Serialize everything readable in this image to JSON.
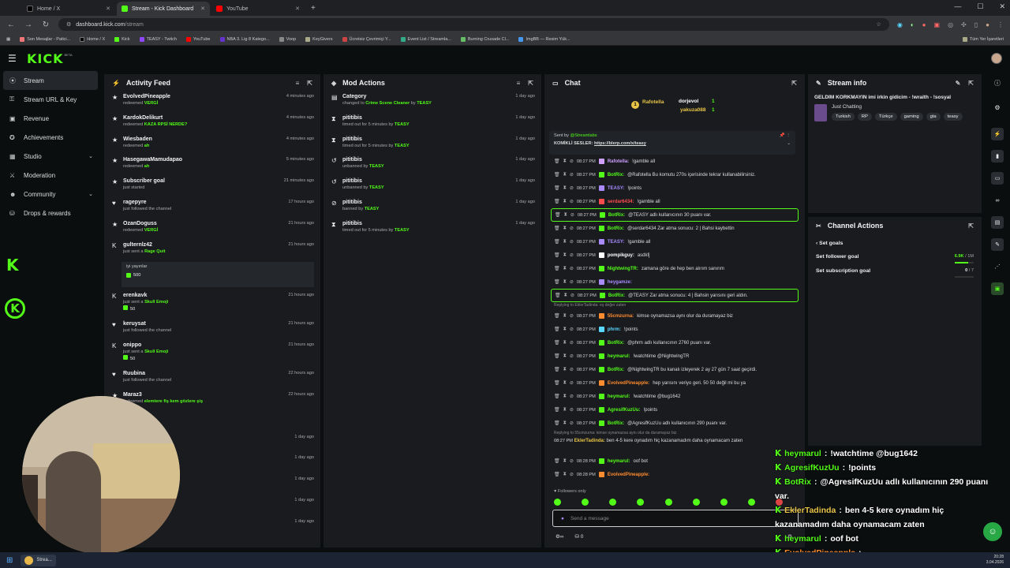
{
  "browser": {
    "tabs": [
      {
        "title": "Home / X",
        "color": "#000000"
      },
      {
        "title": "Stream - Kick Dashboard",
        "color": "#53fc18"
      },
      {
        "title": "YouTube",
        "color": "#ff0000"
      }
    ],
    "url_host": "dashboard.kick.com",
    "url_path": "/stream",
    "bookmarks": [
      "Son Mesajlar - Patici...",
      "Home / X",
      "Kick",
      "TEASY - Twitch",
      "YouTube",
      "NBA 3. Lig 8 Katego...",
      "Voop",
      "KeyGivers",
      "Ücretsiz Çevrimiçi Y...",
      "Event List / Streamla...",
      "Burning Crusade Cl...",
      "ImgBB — Resim Yük..."
    ],
    "bookmarks_right": "Tüm Yer İşaretleri"
  },
  "brand": {
    "logo": "KICK",
    "beta": "BETA",
    "accent": "#53fc18"
  },
  "nav": {
    "items": [
      {
        "label": "Stream",
        "icon": "stream-icon"
      },
      {
        "label": "Stream URL & Key",
        "icon": "key-icon"
      },
      {
        "label": "Revenue",
        "icon": "revenue-icon"
      },
      {
        "label": "Achievements",
        "icon": "achievements-icon"
      },
      {
        "label": "Studio",
        "icon": "studio-icon"
      },
      {
        "label": "Moderation",
        "icon": "moderation-icon"
      },
      {
        "label": "Community",
        "icon": "community-icon"
      },
      {
        "label": "Drops & rewards",
        "icon": "drops-icon"
      }
    ]
  },
  "activity": {
    "title": "Activity Feed",
    "rows": [
      {
        "name": "EvolvedPineapple",
        "pre": "redeemed ",
        "hl": "VERGİ",
        "time": "4 minutes ago",
        "icon": "★"
      },
      {
        "name": "KardokDelikurt",
        "pre": "redeemed ",
        "hl": "KAZA RPSİ NERDE?",
        "time": "4 minutes ago",
        "icon": "★"
      },
      {
        "name": "Wiesbaden",
        "pre": "redeemed ",
        "hl": "ah",
        "time": "4 minutes ago",
        "icon": "★"
      },
      {
        "name": "HasegawaMamudapao",
        "pre": "redeemed ",
        "hl": "ah",
        "time": "5 minutes ago",
        "icon": "★"
      },
      {
        "name": "Subscriber goal",
        "pre": "just started",
        "hl": "",
        "time": "21 minutes ago",
        "icon": "★"
      },
      {
        "name": "ragepyre",
        "pre": "just followed the channel",
        "hl": "",
        "time": "17 hours ago",
        "icon": "♥"
      },
      {
        "name": "OzanDoguss",
        "pre": "redeemed ",
        "hl": "VERGİ",
        "time": "21 hours ago",
        "icon": "★"
      },
      {
        "name": "gulternlz42",
        "pre": "just sent a ",
        "hl": "Rage Quit",
        "time": "21 hours ago",
        "icon": "K"
      }
    ],
    "gift_msg": "iyi yayınlar",
    "gift_amount": "500",
    "rows2": [
      {
        "name": "erenkavk",
        "pre": "just sent a ",
        "hl": "Skull Emoji",
        "time": "21 hours ago",
        "icon": "K",
        "amount": "50"
      },
      {
        "name": "keruysat",
        "pre": "just followed the channel",
        "hl": "",
        "time": "21 hours ago",
        "icon": "♥"
      },
      {
        "name": "onippo",
        "pre": "just sent a ",
        "hl": "Skull Emoji",
        "time": "21 hours ago",
        "icon": "K",
        "amount": "50"
      },
      {
        "name": "Ruubina",
        "pre": "just followed the channel",
        "hl": "",
        "time": "22 hours ago",
        "icon": "♥"
      },
      {
        "name": "Maraz3",
        "pre": "redeemed ",
        "hl": "elemtere fiş kem gözlere şiş",
        "time": "22 hours ago",
        "icon": "★"
      },
      {
        "name": "iber goal",
        "pre": "",
        "hl": "",
        "time": "",
        "icon": ""
      },
      {
        "name": "bscribed!",
        "pre": "bscribed for ",
        "hl": "20",
        "post": " months",
        "time": "1 day ago",
        "icon": ""
      },
      {
        "name": "",
        "pre": "",
        "hl": "",
        "time": "1 day ago",
        "icon": ""
      },
      {
        "name": "",
        "pre": "",
        "hl": "erakittyy",
        "time": "1 day ago",
        "icon": ""
      },
      {
        "name": "bed!",
        "pre": "ubscribed for ",
        "hl": "13",
        "post": " months",
        "time": "1 day ago",
        "icon": ""
      },
      {
        "name": "",
        "pre": "",
        "hl": "eraaii",
        "time": "1 day ago",
        "icon": ""
      }
    ]
  },
  "mod": {
    "title": "Mod Actions",
    "rows": [
      {
        "name": "Category",
        "sub1": "changed to ",
        "hl": "Crime Scene Cleaner",
        "sub2": " by ",
        "by": "TEASY",
        "time": "1 day ago",
        "icon": "▤"
      },
      {
        "name": "pititibis",
        "sub1": "timed out for 5 minutes by ",
        "hl": "",
        "sub2": "",
        "by": "TEASY",
        "time": "1 day ago",
        "icon": "⧗"
      },
      {
        "name": "pititibis",
        "sub1": "timed out for 5 minutes by ",
        "hl": "",
        "sub2": "",
        "by": "TEASY",
        "time": "1 day ago",
        "icon": "⧗"
      },
      {
        "name": "pititibis",
        "sub1": "unbanned by ",
        "hl": "",
        "sub2": "",
        "by": "TEASY",
        "time": "1 day ago",
        "icon": "↺"
      },
      {
        "name": "pititibis",
        "sub1": "unbanned by ",
        "hl": "",
        "sub2": "",
        "by": "TEASY",
        "time": "1 day ago",
        "icon": "↺"
      },
      {
        "name": "pititibis",
        "sub1": "banned by ",
        "hl": "",
        "sub2": "",
        "by": "TEASY",
        "time": "1 day ago",
        "icon": "⊘"
      },
      {
        "name": "pititibis",
        "sub1": "timed out for 5 minutes by ",
        "hl": "",
        "sub2": "",
        "by": "TEASY",
        "time": "1 day ago",
        "icon": "⧗"
      }
    ]
  },
  "chat": {
    "title": "Chat",
    "leaders": [
      {
        "rank": "1",
        "name": "Rafotella",
        "color": "#e8c547"
      },
      {
        "rank": "",
        "name": "dorjevol",
        "color": "#ffffff",
        "count": "1"
      },
      {
        "rank": "",
        "name": "yakuza088",
        "color": "#e8c547",
        "count": "1"
      }
    ],
    "pinned_by": "Sent by",
    "pinned_user": "@Streamlabs",
    "pinned_text_pre": "KOMİKLİ SESLER: ",
    "pinned_link": "https://blerp.com/x/teasy",
    "messages": [
      {
        "time": "08:27 PM",
        "user": "Rafotella:",
        "color": "#cfa0ff",
        "text": "!gamble all",
        "hl": false
      },
      {
        "time": "08:27 PM",
        "user": "BotRix:",
        "color": "#53fc18",
        "text": "@Rafotella Bu komutu 270s içerisinde tekrar kullanabilirsiniz.",
        "hl": false
      },
      {
        "time": "08:27 PM",
        "user": "TEASY:",
        "color": "#a98bff",
        "text": "!points",
        "hl": false
      },
      {
        "time": "08:27 PM",
        "user": "serdar6434:",
        "color": "#ff4d4d",
        "text": "!gamble all",
        "hl": false
      },
      {
        "time": "08:27 PM",
        "user": "BotRix:",
        "color": "#53fc18",
        "text": "@TEASY adlı kullanıcının 30 puanı var.",
        "hl": true
      },
      {
        "time": "08:27 PM",
        "user": "BotRix:",
        "color": "#53fc18",
        "text": "@serdar6434 Zar atma sonucu: 2 | Bahsi kaybettin",
        "hl": false
      },
      {
        "time": "08:27 PM",
        "user": "TEASY:",
        "color": "#a98bff",
        "text": "!gamble all",
        "hl": false
      },
      {
        "time": "08:27 PM",
        "user": "pompikguy:",
        "color": "#ffffff",
        "text": "asdkfj",
        "hl": false
      },
      {
        "time": "08:27 PM",
        "user": "NightwingTR:",
        "color": "#53fc18",
        "text": "zamana göre de hep ben alırım sanırım",
        "hl": false
      },
      {
        "time": "08:27 PM",
        "user": "heygamze:",
        "color": "#a98bff",
        "text": "",
        "hl": false
      },
      {
        "time": "08:27 PM",
        "user": "BotRix:",
        "color": "#53fc18",
        "text": "@TEASY Zar atma sonucu: 4 | Bahsin yarısını geri aldın.",
        "hl": true
      }
    ],
    "reply1": "Replying to EklerTadinda: eş değer zaten",
    "messages2": [
      {
        "time": "08:27 PM",
        "user": "55cmzurna:",
        "color": "#ff8c2e",
        "text": "kimse oynamazsa aynı olur da durama​yaz biz"
      },
      {
        "time": "08:27 PM",
        "user": "phrm:",
        "color": "#5ad8ff",
        "text": "!points"
      },
      {
        "time": "08:27 PM",
        "user": "BotRix:",
        "color": "#53fc18",
        "text": "@phrm adlı kullanıcının 2760 puanı var."
      },
      {
        "time": "08:27 PM",
        "user": "heymarul:",
        "color": "#53fc18",
        "text": "!watchtime @NightwingTR"
      },
      {
        "time": "08:27 PM",
        "user": "BotRix:",
        "color": "#53fc18",
        "text": "@NightwingTR bu kanalı izleyerek 2 ay 27 gün 7 saat geçirdi."
      },
      {
        "time": "08:27 PM",
        "user": "EvolvedPineapple:",
        "color": "#ff8c2e",
        "text": "hep yarısını veriyo geri. 50 50 değil mi bu ya"
      },
      {
        "time": "08:27 PM",
        "user": "heymarul:",
        "color": "#53fc18",
        "text": "!watchtime @bug1642"
      },
      {
        "time": "08:27 PM",
        "user": "AgresifKuzUu:",
        "color": "#53fc18",
        "text": "!points"
      },
      {
        "time": "08:27 PM",
        "user": "BotRix:",
        "color": "#53fc18",
        "text": "@AgresifKuzUu adlı kullanıcının 290 puanı var."
      }
    ],
    "reply2": "Replying to 55cmzurna: kimse oynamazsa aynı olur da durama​yaz biz",
    "msg_ekler_time": "08:27 PM",
    "msg_ekler_user": "EklerTadinda:",
    "msg_ekler_text": "ben 4-5 kere oynadım hiç kazanamadım daha oynamacam zaten",
    "messages3": [
      {
        "time": "08:28 PM",
        "user": "heymarul:",
        "color": "#53fc18",
        "text": "oof bot"
      },
      {
        "time": "08:28 PM",
        "user": "EvolvedPineapple:",
        "color": "#ff8c2e",
        "text": ""
      }
    ],
    "followers_only": "Followers only",
    "input_placeholder": "Send a message",
    "points": "0"
  },
  "stream_info": {
    "title": "Stream info",
    "stream_title": "GELDİM KORKMAYIN imi irkin gidicim - !wraith - !sosyal",
    "category": "Just Chatting",
    "tags": [
      "Turkish",
      "RP",
      "Türkçe",
      "gaming",
      "gta",
      "teasy"
    ]
  },
  "channel_actions": {
    "title": "Channel Actions",
    "back": "Set goals",
    "follower_goal": "Set follower goal",
    "follower_val": "6.9K",
    "follower_max": " / 1M",
    "follower_progress": 0.69,
    "sub_goal": "Set subscription goal",
    "sub_val": "0",
    "sub_max": " / 7",
    "sub_progress": 0.0
  },
  "overlay": [
    {
      "user": "heymarul",
      "text": "!watchtime @bug1642",
      "color": "#53fc18"
    },
    {
      "user": "AgresifKuzUu",
      "text": "!points",
      "color": "#53fc18"
    },
    {
      "user": "BotRix",
      "text": "@AgresifKuzUu adlı kullanıcının 290 puanı",
      "color": "#53fc18"
    },
    {
      "user": "",
      "text": "var.",
      "color": "#ffffff"
    },
    {
      "user": "EklerTadinda",
      "text": "ben 4-5 kere oynadım hiç",
      "color": "#e8c547"
    },
    {
      "user": "",
      "text": "kazanamadım daha oynamacam zaten",
      "color": "#ffffff"
    },
    {
      "user": "heymarul",
      "text": "oof bot",
      "color": "#53fc18"
    },
    {
      "user": "EvolvedPineapple",
      "text": "",
      "color": "#ff8c2e"
    }
  ],
  "taskbar": {
    "apps": [
      "Strea..."
    ],
    "time": "20:28",
    "date": "3.04.2026"
  }
}
